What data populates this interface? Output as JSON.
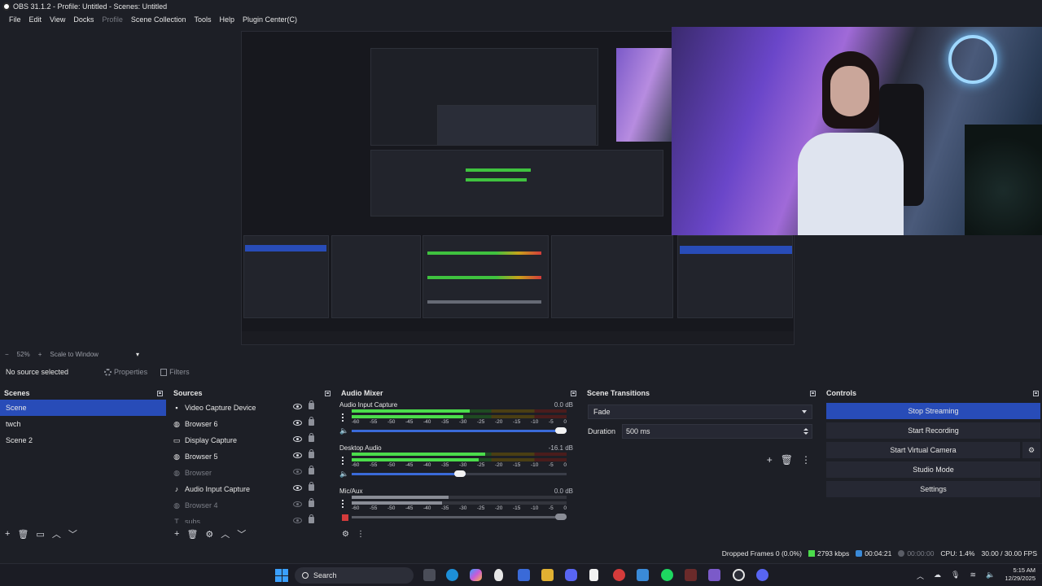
{
  "window": {
    "title": "OBS 31.1.2 - Profile: Untitled - Scenes: Untitled"
  },
  "menu": [
    "File",
    "Edit",
    "View",
    "Docks",
    "Profile",
    "Scene Collection",
    "Tools",
    "Help",
    "Plugin Center(C)"
  ],
  "zoom": {
    "minus": "−",
    "value": "52%",
    "plus": "+",
    "mode": "Scale to Window",
    "caret": "▾"
  },
  "source_toolbar": {
    "no_source": "No source selected",
    "properties": "Properties",
    "filters": "Filters"
  },
  "scenes": {
    "title": "Scenes",
    "items": [
      "Scene",
      "twch",
      "Scene 2"
    ],
    "selected": 0
  },
  "sources": {
    "title": "Sources",
    "items": [
      {
        "name": "Video Capture Device",
        "visible": true,
        "icon": "camera-icon"
      },
      {
        "name": "Browser 6",
        "visible": true,
        "icon": "globe-icon"
      },
      {
        "name": "Display Capture",
        "visible": true,
        "icon": "monitor-icon"
      },
      {
        "name": "Browser 5",
        "visible": true,
        "icon": "globe-icon"
      },
      {
        "name": "Browser",
        "visible": false,
        "icon": "globe-icon"
      },
      {
        "name": "Audio Input Capture",
        "visible": true,
        "icon": "microphone-icon"
      },
      {
        "name": "Browser 4",
        "visible": false,
        "icon": "globe-icon"
      },
      {
        "name": "subs",
        "visible": false,
        "icon": "text-icon"
      }
    ]
  },
  "audio": {
    "title": "Audio Mixer",
    "ticks": [
      "-60",
      "-55",
      "-50",
      "-45",
      "-40",
      "-35",
      "-30",
      "-25",
      "-20",
      "-15",
      "-10",
      "-5",
      "0"
    ],
    "channels": [
      {
        "name": "Audio Input Capture",
        "db": "0.0 dB",
        "level": 0.55,
        "volume": 1.0,
        "active": true
      },
      {
        "name": "Desktop Audio",
        "db": "-16.1 dB",
        "level": 0.62,
        "volume": 0.53,
        "active": true
      },
      {
        "name": "Mic/Aux",
        "db": "0.0 dB",
        "level": 0.45,
        "volume": 1.0,
        "active": false
      }
    ]
  },
  "transitions": {
    "title": "Scene Transitions",
    "selected": "Fade",
    "duration_label": "Duration",
    "duration_value": "500 ms"
  },
  "controls": {
    "title": "Controls",
    "buttons": [
      "Stop Streaming",
      "Start Recording",
      "Start Virtual Camera",
      "Studio Mode",
      "Settings"
    ]
  },
  "status": {
    "dropped": "Dropped Frames 0 (0.0%)",
    "bitrate": "2793 kbps",
    "stream_time": "00:04:21",
    "rec_time": "00:00:00",
    "cpu": "CPU: 1.4%",
    "fps": "30.00 / 30.00 FPS"
  },
  "taskbar": {
    "search": "Search",
    "time": "5:15 AM",
    "date": "12/29/2025"
  },
  "colors": {
    "accent": "#284cb8",
    "meter_green": "#4bdc4b",
    "meter_yellow": "#c8a21a",
    "meter_red": "#d43b3b"
  }
}
